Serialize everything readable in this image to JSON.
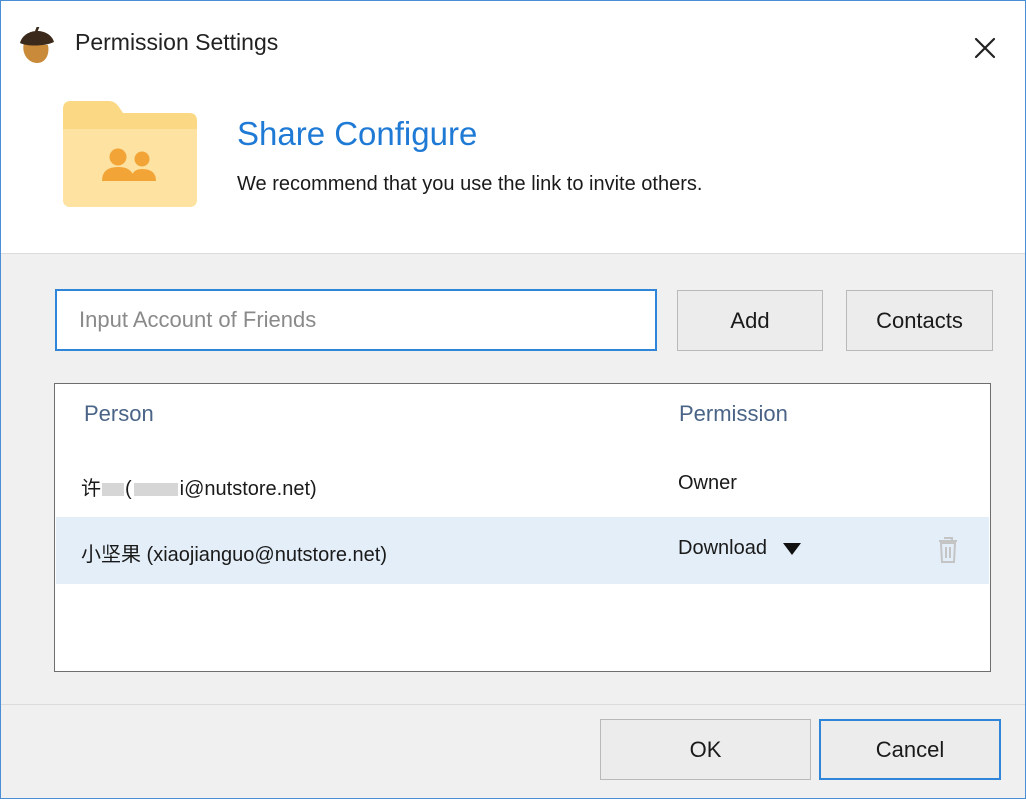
{
  "window": {
    "title": "Permission Settings",
    "close_icon": "close-icon",
    "app_icon": "acorn-icon"
  },
  "header": {
    "title": "Share Configure",
    "subtitle": "We recommend that you use the link to invite others.",
    "icon": "shared-folder-icon"
  },
  "invite": {
    "placeholder": "Input Account of Friends",
    "value": "",
    "add_label": "Add",
    "contacts_label": "Contacts"
  },
  "list": {
    "columns": {
      "person": "Person",
      "permission": "Permission"
    },
    "rows": [
      {
        "person_prefix": "许",
        "person_open": "(",
        "person_suffix": "i@nutstore.net)",
        "permission": "Owner"
      },
      {
        "person": "小坚果 (xiaojianguo@nutstore.net)",
        "permission": "Download",
        "selected": true
      }
    ]
  },
  "footer": {
    "ok_label": "OK",
    "cancel_label": "Cancel"
  },
  "colors": {
    "accent": "#1f7ad6",
    "focus_border": "#2f86d9",
    "selected_row": "#e3eef9",
    "folder": "#fbd984",
    "column_header": "#4a6487"
  }
}
